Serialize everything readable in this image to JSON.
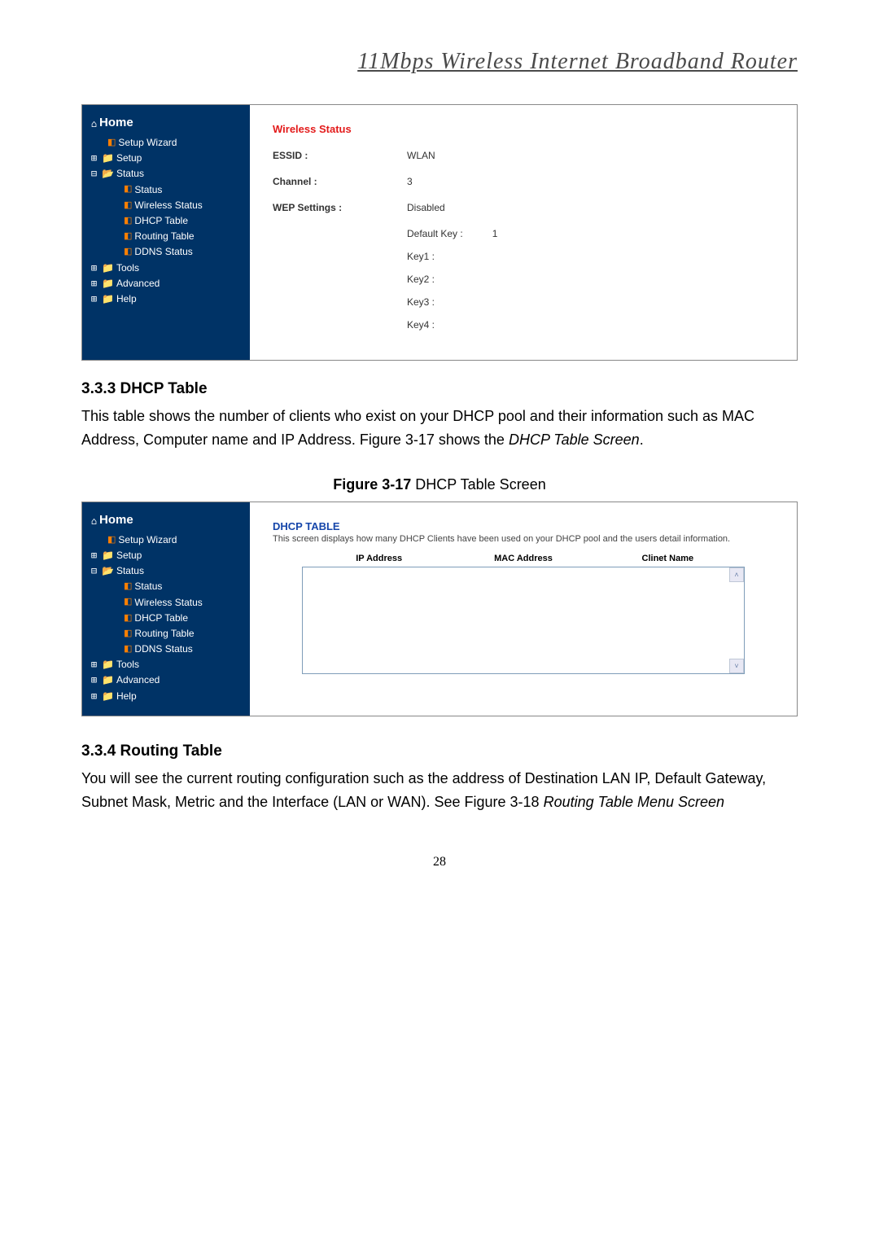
{
  "doc_title": "11Mbps  Wireless  Internet  Broadband  Router",
  "tree": {
    "home": "Home",
    "setup_wizard": "Setup Wizard",
    "setup": "Setup",
    "status": "Status",
    "status_sub": "Status",
    "wireless_status": "Wireless Status",
    "dhcp_table": "DHCP Table",
    "routing_table": "Routing Table",
    "ddns_status": "DDNS Status",
    "tools": "Tools",
    "advanced": "Advanced",
    "help": "Help"
  },
  "panel1": {
    "title": "Wireless Status",
    "essid_label": "ESSID :",
    "essid_val": "WLAN",
    "channel_label": "Channel :",
    "channel_val": "3",
    "wep_label": "WEP Settings :",
    "wep_val": "Disabled",
    "default_key_label": "Default Key :",
    "default_key_val": "1",
    "key1": "Key1 :",
    "key2": "Key2 :",
    "key3": "Key3 :",
    "key4": "Key4 :"
  },
  "section333": {
    "heading": "3.3.3 DHCP Table",
    "body_1": "This table shows the number of clients who exist on your DHCP pool and their information such as MAC Address, Computer name and IP Address. Figure 3-17 shows the ",
    "body_1_italic": "DHCP Table Screen",
    "body_1_end": ".",
    "figure_bold": "Figure 3-17",
    "figure_rest": " DHCP Table Screen"
  },
  "panel2": {
    "title": "DHCP TABLE",
    "sub": "This screen displays how many DHCP Clients have been used on your DHCP pool and the users detail information.",
    "col_ip": "IP Address",
    "col_mac": "MAC Address",
    "col_name": "Clinet Name"
  },
  "section334": {
    "heading": "3.3.4 Routing Table",
    "body_1": "You will see the current routing configuration such as the address of Destination LAN IP, Default Gateway, Subnet Mask, Metric and the Interface (LAN or WAN). See Figure 3-18 ",
    "body_1_italic": "Routing Table Menu Screen"
  },
  "page_number": "28"
}
